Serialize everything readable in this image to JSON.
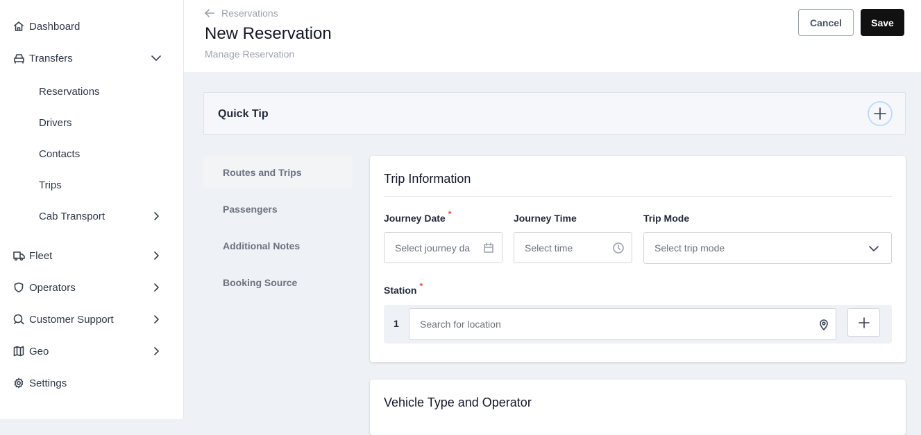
{
  "sidebar": {
    "items": [
      {
        "label": "Dashboard",
        "icon": "home-icon"
      },
      {
        "label": "Transfers",
        "icon": "car-icon"
      },
      {
        "label": "Reservations"
      },
      {
        "label": "Drivers"
      },
      {
        "label": "Contacts"
      },
      {
        "label": "Trips"
      },
      {
        "label": "Cab Transport"
      },
      {
        "label": "Fleet",
        "icon": "truck-icon"
      },
      {
        "label": "Operators",
        "icon": "shield-icon"
      },
      {
        "label": "Customer Support",
        "icon": "chat-icon"
      },
      {
        "label": "Geo",
        "icon": "map-icon"
      },
      {
        "label": "Settings",
        "icon": "gear-icon"
      }
    ]
  },
  "header": {
    "breadcrumb": "Reservations",
    "title": "New Reservation",
    "subtitle": "Manage Reservation",
    "cancel": "Cancel",
    "save": "Save"
  },
  "quick_tip": {
    "title": "Quick Tip"
  },
  "tabs": [
    "Routes and Trips",
    "Passengers",
    "Additional Notes",
    "Booking Source"
  ],
  "trip": {
    "title": "Trip Information",
    "journey_date_label": "Journey Date",
    "journey_date_placeholder": "Select journey da",
    "journey_time_label": "Journey Time",
    "journey_time_placeholder": "Select time",
    "trip_mode_label": "Trip Mode",
    "trip_mode_placeholder": "Select trip mode",
    "station_label": "Station",
    "required_mark": "*",
    "station_index": "1",
    "station_placeholder": "Search for location"
  },
  "vehicle": {
    "title": "Vehicle Type and Operator"
  }
}
